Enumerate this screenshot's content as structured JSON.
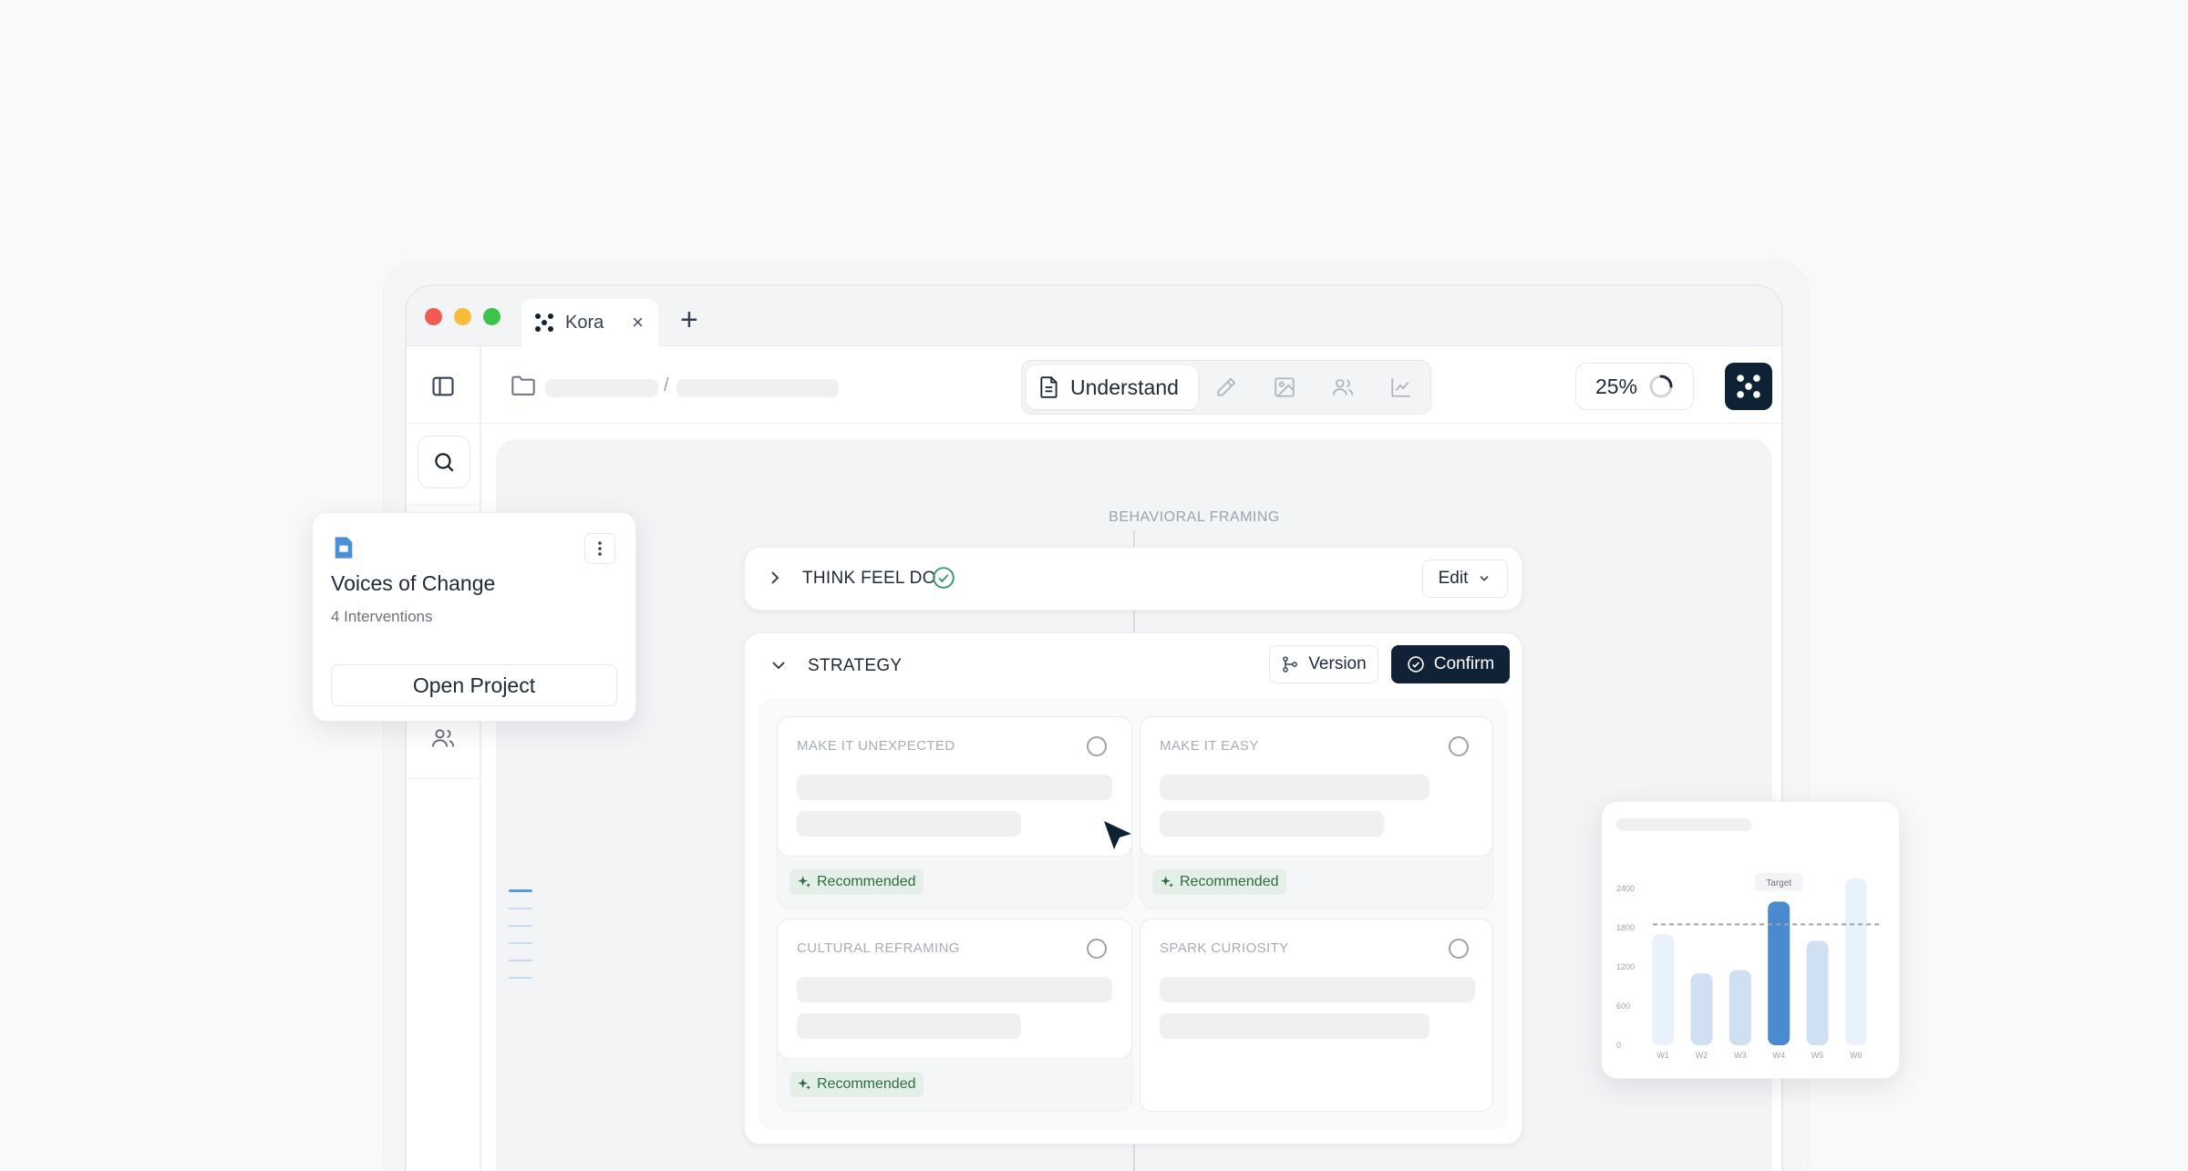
{
  "tab": {
    "title": "Kora",
    "close": "×",
    "new": "+"
  },
  "mode_bar": {
    "active": "Understand"
  },
  "zoom": {
    "value": "25%",
    "progress": 0.25
  },
  "canvas": {
    "section_label": "BEHAVIORAL FRAMING",
    "think_feel_do": {
      "title": "THINK FEEL DO",
      "edit_label": "Edit"
    },
    "strategy": {
      "title": "STRATEGY",
      "version_label": "Version",
      "confirm_label": "Confirm",
      "options": [
        {
          "title": "MAKE IT UNEXPECTED",
          "badge": "Recommended"
        },
        {
          "title": "MAKE IT EASY",
          "badge": "Recommended"
        },
        {
          "title": "CULTURAL REFRAMING",
          "badge": "Recommended"
        },
        {
          "title": "SPARK CURIOSITY",
          "badge": ""
        }
      ]
    }
  },
  "project_popup": {
    "title": "Voices of Change",
    "subtitle": "4 Interventions",
    "button": "Open Project"
  },
  "chart_data": {
    "type": "bar",
    "categories": [
      "W1",
      "W2",
      "W3",
      "W4",
      "W5",
      "W6"
    ],
    "values": [
      1700,
      1100,
      1150,
      2200,
      1600,
      2550
    ],
    "ylim": [
      0,
      2400
    ],
    "yticks": [
      "0",
      "600",
      "1200",
      "1800",
      "2400"
    ],
    "target": {
      "label": "Target",
      "value": 1850
    },
    "highlight_index": 3,
    "colors": {
      "highlight": "#4a8bd0",
      "mid": "#cfe0f3",
      "light": "#e9f1fa"
    }
  },
  "colors": {
    "brand": "#0f2233",
    "accent_green": "#2f6b45",
    "doc_blue": "#4a90d9"
  }
}
